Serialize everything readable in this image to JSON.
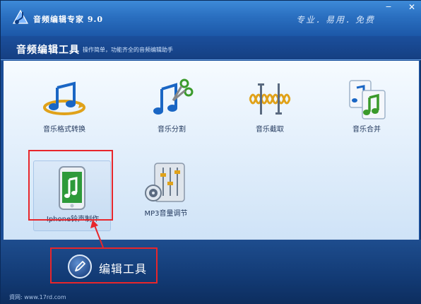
{
  "window": {
    "title": "音频编辑专家 9.0",
    "slogan": "专业．易用．免费",
    "minimize_icon": "−",
    "close_icon": "✕"
  },
  "header": {
    "title": "音频编辑工具",
    "subtitle": "操作简单，功能齐全的音频编辑助手"
  },
  "tools": [
    {
      "label": "音乐格式转换",
      "icon": "music-convert-icon"
    },
    {
      "label": "音乐分割",
      "icon": "music-split-icon"
    },
    {
      "label": "音乐截取",
      "icon": "music-cut-icon"
    },
    {
      "label": "音乐合并",
      "icon": "music-merge-icon"
    },
    {
      "label": "Iphone铃声制作",
      "icon": "iphone-ringtone-icon",
      "highlighted": true
    },
    {
      "label": "MP3音量调节",
      "icon": "mp3-volume-icon"
    }
  ],
  "footer": {
    "edit_label": "编辑工具",
    "watermark": "資网: www.17rd.com"
  },
  "colors": {
    "annotation_red": "#e8262b",
    "title_bar": "#2a6fc0",
    "content_bg": "#e6f1fc"
  }
}
